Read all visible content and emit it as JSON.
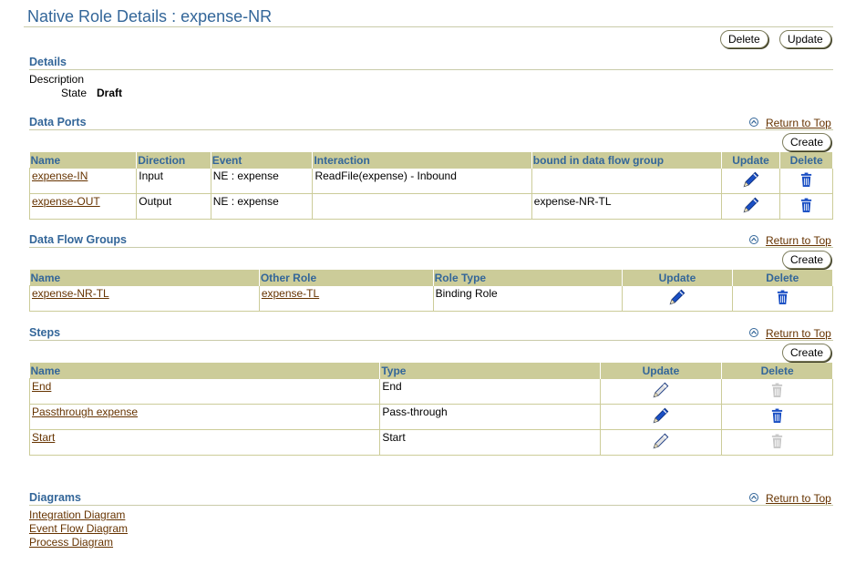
{
  "page": {
    "title": "Native Role Details : expense-NR",
    "delete_label": "Delete",
    "update_label": "Update",
    "return_to_top": "Return to Top",
    "create_label": "Create"
  },
  "details": {
    "heading": "Details",
    "description_label": "Description",
    "state_label": "State",
    "state_value": "Draft"
  },
  "data_ports": {
    "heading": "Data Ports",
    "columns": [
      "Name",
      "Direction",
      "Event",
      "Interaction",
      "bound in data flow group",
      "Update",
      "Delete"
    ],
    "rows": [
      {
        "name": "expense-IN",
        "direction": "Input",
        "event": "NE : expense",
        "interaction": "ReadFile(expense) - Inbound",
        "bound": ""
      },
      {
        "name": "expense-OUT",
        "direction": "Output",
        "event": "NE : expense",
        "interaction": "",
        "bound": "expense-NR-TL"
      }
    ]
  },
  "data_flow_groups": {
    "heading": "Data Flow Groups",
    "columns": [
      "Name",
      "Other Role",
      "Role Type",
      "Update",
      "Delete"
    ],
    "rows": [
      {
        "name": "expense-NR-TL",
        "other_role": "expense-TL",
        "role_type": "Binding Role"
      }
    ]
  },
  "steps": {
    "heading": "Steps",
    "columns": [
      "Name",
      "Type",
      "Update",
      "Delete"
    ],
    "rows": [
      {
        "name": "End",
        "type": "End",
        "enabled": false
      },
      {
        "name": "Passthrough expense",
        "type": "Pass-through",
        "enabled": true
      },
      {
        "name": "Start",
        "type": "Start",
        "enabled": false
      }
    ]
  },
  "diagrams": {
    "heading": "Diagrams",
    "links": [
      "Integration Diagram",
      "Event Flow Diagram",
      "Process Diagram"
    ]
  },
  "icons": {
    "update": "pencil-icon",
    "delete": "trash-icon",
    "return": "up-arrow-icon"
  },
  "colors": {
    "accent": "#336699",
    "header_bg": "#cccc99",
    "link": "#663300",
    "icon_blue": "#1a4fc4",
    "icon_disabled": "#c8c8c8"
  }
}
